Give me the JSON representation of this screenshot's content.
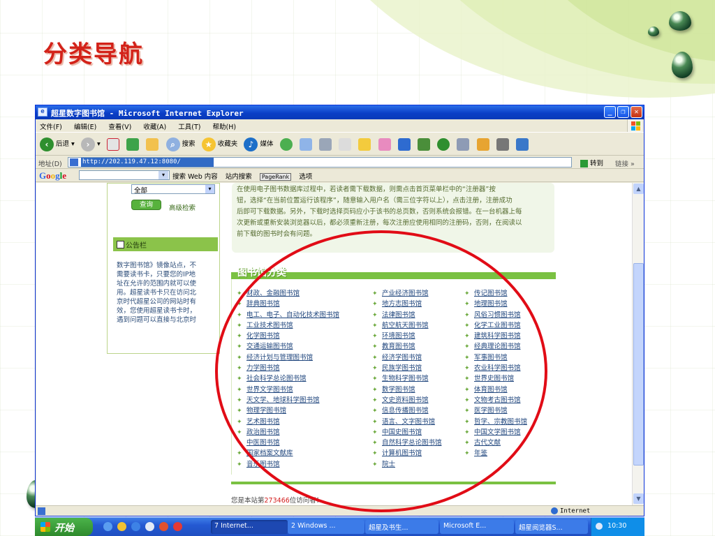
{
  "slide": {
    "title": "分类导航"
  },
  "window": {
    "title": "超星数字图书馆 - Microsoft Internet Explorer",
    "menu": [
      "文件(F)",
      "编辑(E)",
      "查看(V)",
      "收藏(A)",
      "工具(T)",
      "帮助(H)"
    ],
    "toolbar": {
      "back": "后退",
      "search": "搜索",
      "favorites": "收藏夹",
      "media": "媒体"
    },
    "address": {
      "label": "地址(D)",
      "url": "http://202.119.47.12:8080/",
      "go": "转到",
      "links": "链接 »"
    },
    "google": {
      "logo": "Google",
      "search_web": "搜索 Web 内容",
      "site_search": "站内搜索",
      "pagerank": "PageRank",
      "options": "选项"
    },
    "status_zone": "Internet"
  },
  "page": {
    "select_value": "全部",
    "query_button": "查询",
    "advanced_search": "高级检索",
    "notice_title": "公告栏",
    "notice_text": "数字图书馆》镜像站点，不\n需要读书卡，只要您的IP地\n址在允许的范围内就可以使\n用。超星读书卡只在访问北\n京时代超星公司的网站时有\n效，您使用超星读书卡时，\n遇到问题可以直接与北京时",
    "intro_text": "在使用电子图书数据库过程中，若读者需下载数据，则需点击首页菜单栏中的“注册器”按\n钮，选择“在当前位置运行该程序”，随意输入用户名（需三位字符以上），点击注册，注册成功\n后即可下载数据。另外，下载时选择页码应小于该书的总页数，否则系统会报错。在一台机器上每\n次更新或重新安装浏览器以后，都必须重新注册，每次注册应使用相同的注册码，否则，在阅读以\n前下载的图书时会有问题。",
    "category_title": "图书馆分类",
    "categories": {
      "col1": [
        "财政、金融图书馆",
        "辞典图书馆",
        "电工、电子、自动化技术图书馆",
        "工业技术图书馆",
        "化学图书馆",
        "交通运输图书馆",
        "经济计划与管理图书馆",
        "力学图书馆",
        "社会科学总论图书馆",
        "世界文学图书馆",
        "天文学、地球科学图书馆",
        "物理学图书馆",
        "艺术图书馆",
        "政治图书馆",
        "中医图书馆",
        "国家档案文献库",
        "音乐图书馆"
      ],
      "col2": [
        "产业经济图书馆",
        "地方志图书馆",
        "法律图书馆",
        "航空航天图书馆",
        "环境图书馆",
        "教育图书馆",
        "经济学图书馆",
        "民族学图书馆",
        "生物科学图书馆",
        "数学图书馆",
        "文史资料图书馆",
        "信息传播图书馆",
        "语言、文字图书馆",
        "中国史图书馆",
        "自然科学总论图书馆",
        "计算机图书馆",
        "院士"
      ],
      "col3": [
        "传记图书馆",
        "地理图书馆",
        "风俗习惯图书馆",
        "化学工业图书馆",
        "建筑科学图书馆",
        "经典理论图书馆",
        "军事图书馆",
        "农业科学图书馆",
        "世界史图书馆",
        "体育图书馆",
        "文物考古图书馆",
        "医学图书馆",
        "哲学、宗教图书馆",
        "中国文学图书馆",
        "古代文献",
        "年鉴"
      ]
    },
    "counter_prefix": "您是本站第",
    "counter_value": "273466",
    "counter_suffix": "位访问者！"
  },
  "taskbar": {
    "start": "开始",
    "tasks": [
      "7 Internet...",
      "2 Windows ...",
      "超星及书生...",
      "Microsoft E...",
      "超星阅览器S..."
    ],
    "clock": "10:30"
  },
  "colors": {
    "title_red": "#d32219",
    "annotation_red": "#e10c16",
    "page_green": "#7ac142",
    "xp_blue": "#0a3fc7"
  }
}
